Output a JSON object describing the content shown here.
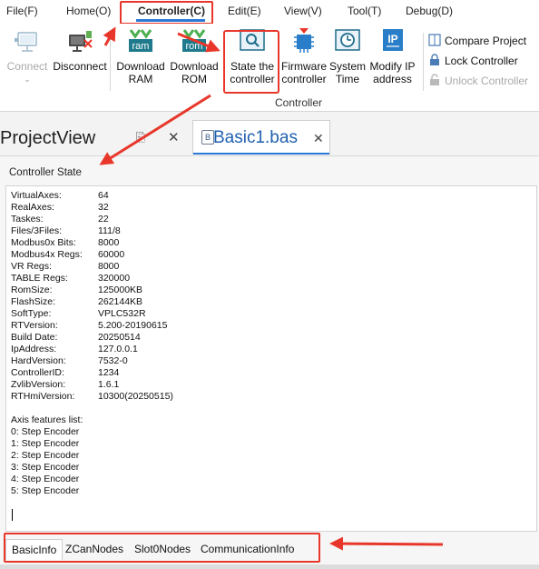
{
  "menu": {
    "items": [
      "File(F)",
      "Home(O)",
      "Controller(C)",
      "Edit(E)",
      "View(V)",
      "Tool(T)",
      "Debug(D)"
    ]
  },
  "ribbon": {
    "connect": "Connect",
    "disconnect": "Disconnect",
    "download_ram_1": "Download",
    "download_ram_2": "RAM",
    "download_rom_1": "Download",
    "download_rom_2": "ROM",
    "state_1": "State the",
    "state_2": "controller",
    "firmware_1": "Firmware",
    "firmware_2": "controller",
    "systime_1": "System",
    "systime_2": "Time",
    "modifyip_1": "Modify IP",
    "modifyip_2": "address",
    "ram_icon_text": "ram",
    "rom_icon_text": "rom",
    "ip_icon_text": "IP",
    "group_label": "Controller",
    "compare_project": "Compare Project",
    "lock_controller": "Lock Controller",
    "unlock_controller": "Unlock Controller"
  },
  "panels": {
    "project_view_title": "ProjectView",
    "doc_tab_label": "Basic1.bas",
    "doc_tab_icon": "B"
  },
  "controller_state": {
    "title": "Controller State",
    "rows": [
      {
        "key": "VirtualAxes:",
        "value": "64"
      },
      {
        "key": "RealAxes:",
        "value": "32"
      },
      {
        "key": "Taskes:",
        "value": "22"
      },
      {
        "key": "Files/3Files:",
        "value": "111/8"
      },
      {
        "key": "Modbus0x Bits:",
        "value": "8000"
      },
      {
        "key": "Modbus4x Regs:",
        "value": "60000"
      },
      {
        "key": "VR Regs:",
        "value": "8000"
      },
      {
        "key": "TABLE Regs:",
        "value": "320000"
      },
      {
        "key": "RomSize:",
        "value": "125000KB"
      },
      {
        "key": "FlashSize:",
        "value": "262144KB"
      },
      {
        "key": "SoftType:",
        "value": "VPLC532R"
      },
      {
        "key": "RTVersion:",
        "value": "5.200-20190615"
      },
      {
        "key": "Build Date:",
        "value": "20250514"
      },
      {
        "key": "IpAddress:",
        "value": "127.0.0.1"
      },
      {
        "key": "HardVersion:",
        "value": "7532-0"
      },
      {
        "key": "ControllerID:",
        "value": "1234"
      },
      {
        "key": "ZvlibVersion:",
        "value": "1.6.1"
      },
      {
        "key": "RTHmiVersion:",
        "value": "10300(20250515)"
      }
    ],
    "axis_features_title": "Axis features list:",
    "axis_features": [
      "0: Step Encoder",
      "1: Step Encoder",
      "2: Step Encoder",
      "3: Step Encoder",
      "4: Step Encoder",
      "5: Step Encoder"
    ]
  },
  "bottom_tabs": [
    "BasicInfo",
    "ZCanNodes",
    "Slot0Nodes",
    "CommunicationInfo"
  ],
  "colors": {
    "highlight_red": "#e8372a",
    "accent_blue": "#2b79d6",
    "download_green": "#4caf50",
    "icon_teal": "#1e7a8c"
  }
}
